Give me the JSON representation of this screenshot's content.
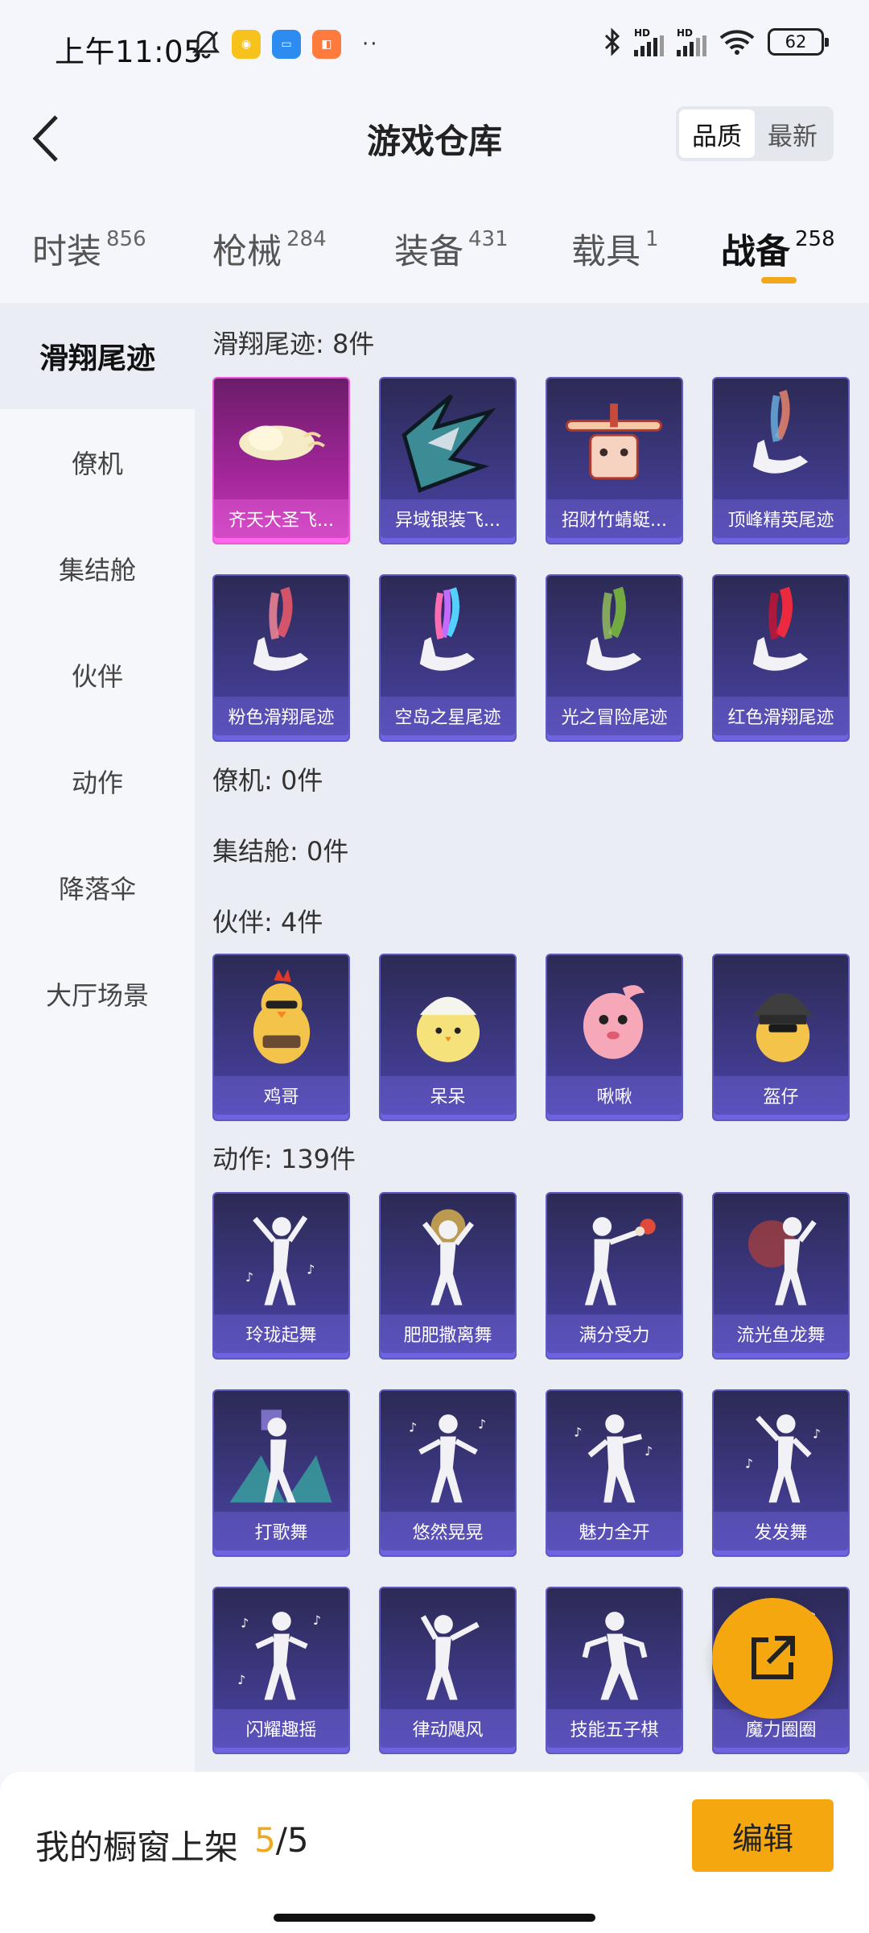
{
  "status_bar": {
    "time": "上午11:05",
    "battery": "62",
    "signal_label_1": "HD",
    "signal_label_2": "HD",
    "dots": "··"
  },
  "header": {
    "title": "游戏仓库",
    "sort_quality": "品质",
    "sort_latest": "最新"
  },
  "tabs": [
    {
      "label": "时装",
      "count": "856"
    },
    {
      "label": "枪械",
      "count": "284"
    },
    {
      "label": "装备",
      "count": "431"
    },
    {
      "label": "载具",
      "count": "1"
    },
    {
      "label": "战备",
      "count": "258",
      "active": true
    }
  ],
  "sidebar": [
    {
      "label": "滑翔尾迹",
      "active": true
    },
    {
      "label": "僚机"
    },
    {
      "label": "集结舱"
    },
    {
      "label": "伙伴"
    },
    {
      "label": "动作"
    },
    {
      "label": "降落伞"
    },
    {
      "label": "大厅场景"
    }
  ],
  "sections": {
    "glide": {
      "title": "滑翔尾迹: 8件",
      "items": [
        "齐天大圣飞...",
        "异域银装飞...",
        "招财竹蜻蜓...",
        "顶峰精英尾迹",
        "粉色滑翔尾迹",
        "空岛之星尾迹",
        "光之冒险尾迹",
        "红色滑翔尾迹"
      ]
    },
    "wingman": {
      "title": "僚机: 0件"
    },
    "capsule": {
      "title": "集结舱: 0件"
    },
    "partner": {
      "title": "伙伴: 4件",
      "items": [
        "鸡哥",
        "呆呆",
        "啾啾",
        "盔仔"
      ]
    },
    "emote": {
      "title": "动作: 139件",
      "items": [
        "玲珑起舞",
        "肥肥撒离舞",
        "满分受力",
        "流光鱼龙舞",
        "打歌舞",
        "悠然晃晃",
        "魅力全开",
        "发发舞",
        "闪耀趣摇",
        "律动飓风",
        "技能五子棋",
        "魔力圈圈"
      ]
    }
  },
  "bottom_bar": {
    "label": "我的橱窗上架",
    "current": "5",
    "separator": "/",
    "total": "5",
    "edit_label": "编辑"
  },
  "colors": {
    "accent": "#f5a70f",
    "card_purple": "#3d3882",
    "card_pink": "#a3279a"
  }
}
